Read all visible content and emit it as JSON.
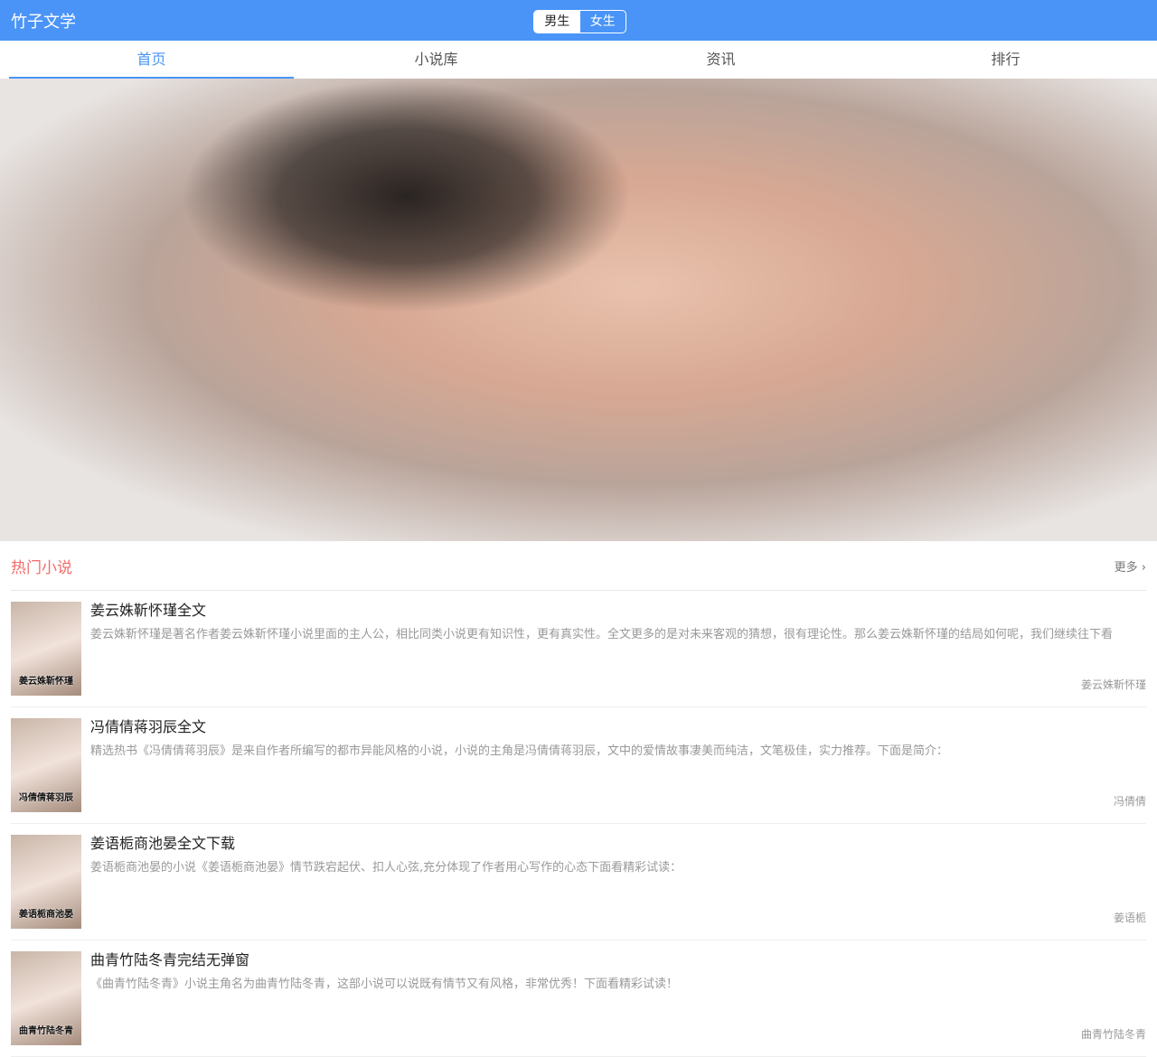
{
  "header": {
    "title": "竹子文学",
    "gender": [
      "男生",
      "女生"
    ]
  },
  "tabs": [
    "首页",
    "小说库",
    "资讯",
    "排行"
  ],
  "section": {
    "title": "热门小说",
    "more": "更多"
  },
  "books": [
    {
      "title": "姜云姝靳怀瑾全文",
      "desc": "姜云姝靳怀瑾是著名作者姜云姝靳怀瑾小说里面的主人公，相比同类小说更有知识性，更有真实性。全文更多的是对未来客观的猜想，很有理论性。那么姜云姝靳怀瑾的结局如何呢，我们继续往下看",
      "author": "姜云姝靳怀瑾",
      "cover": "姜云姝靳怀瑾"
    },
    {
      "title": "冯倩倩蒋羽辰全文",
      "desc": "精选热书《冯倩倩蒋羽辰》是来自作者所编写的都市异能风格的小说，小说的主角是冯倩倩蒋羽辰，文中的爱情故事凄美而纯洁，文笔极佳，实力推荐。下面是简介：",
      "author": "冯倩倩",
      "cover": "冯倩倩蒋羽辰"
    },
    {
      "title": "姜语栀商池晏全文下载",
      "desc": "姜语栀商池晏的小说《姜语栀商池晏》情节跌宕起伏、扣人心弦,充分体现了作者用心写作的心态下面看精彩试读：",
      "author": "姜语栀",
      "cover": "姜语栀商池晏"
    },
    {
      "title": "曲青竹陆冬青完结无弹窗",
      "desc": "《曲青竹陆冬青》小说主角名为曲青竹陆冬青，这部小说可以说既有情节又有风格，非常优秀！下面看精彩试读！",
      "author": "曲青竹陆冬青",
      "cover": "曲青竹陆冬青"
    }
  ]
}
